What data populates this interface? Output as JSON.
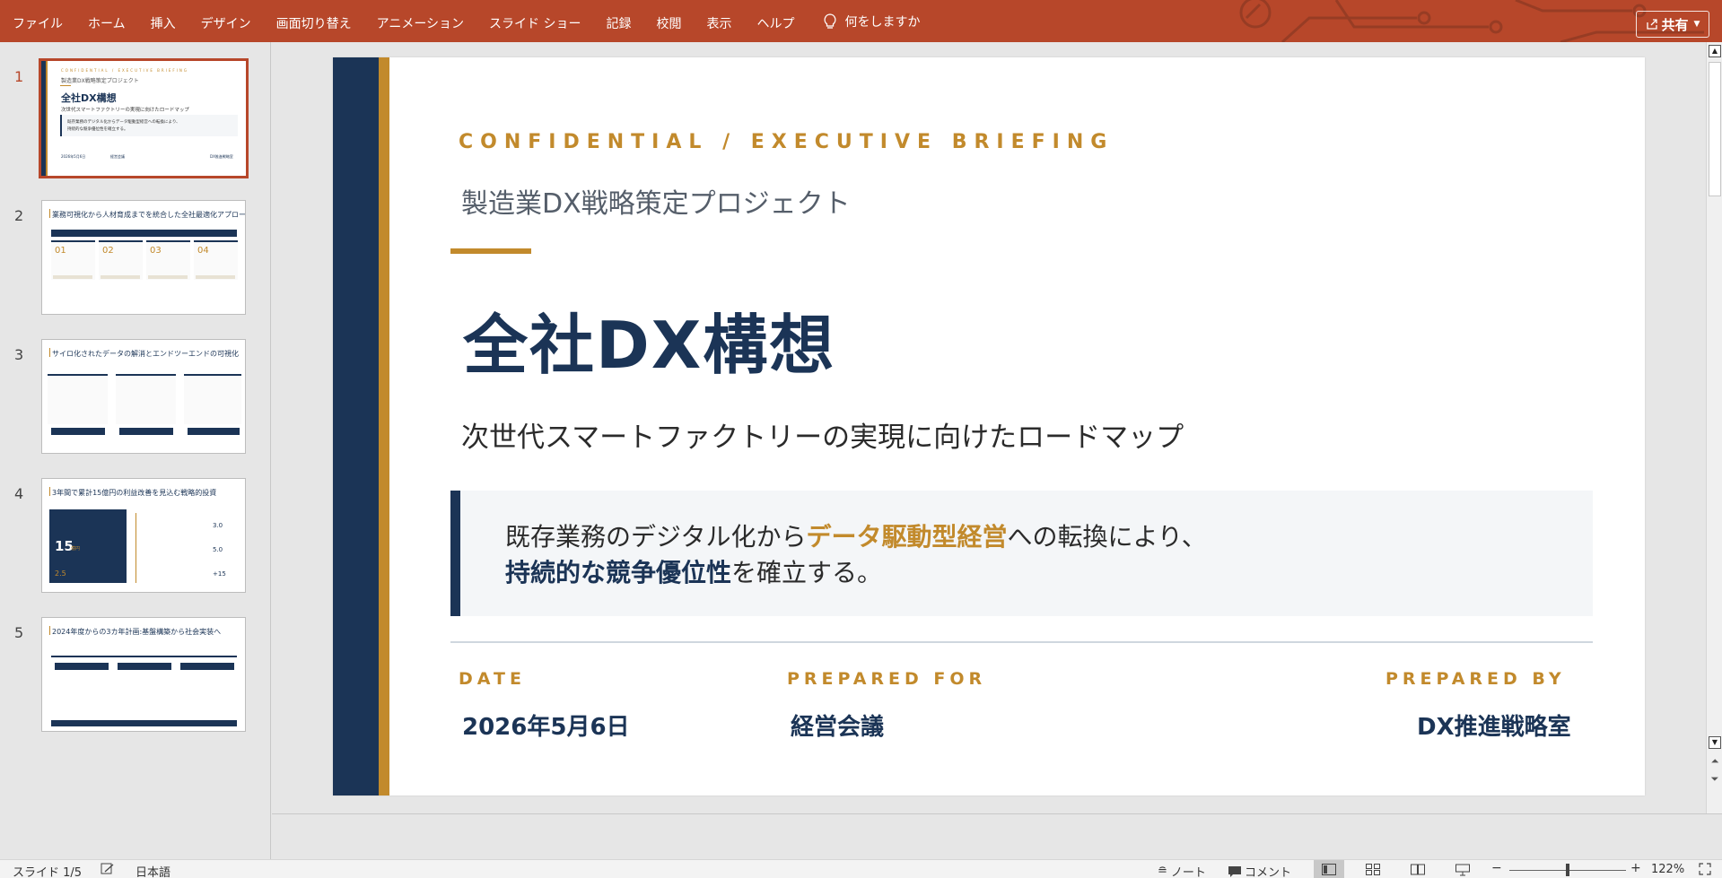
{
  "ribbon": {
    "tabs": [
      "ファイル",
      "ホーム",
      "挿入",
      "デザイン",
      "画面切り替え",
      "アニメーション",
      "スライド ショー",
      "記録",
      "校閲",
      "表示",
      "ヘルプ"
    ],
    "tell_me": "何をしますか",
    "share_label": "共有",
    "bg_color": "#b7472a"
  },
  "thumbnails": [
    {
      "number": "1",
      "active": true
    },
    {
      "number": "2",
      "active": false
    },
    {
      "number": "3",
      "active": false
    },
    {
      "number": "4",
      "active": false
    },
    {
      "number": "5",
      "active": false
    }
  ],
  "thumb_text": {
    "t1": {
      "kicker": "CONFIDENTIAL / EXECUTIVE BRIEFING",
      "project": "製造業DX戦略策定プロジェクト",
      "title": "全社DX構想",
      "subtitle": "次世代スマートファクトリーの実現に向けたロードマップ",
      "callout_1": "既存業務のデジタル化からデータ駆動型経営への転換により、",
      "callout_2": "持続的な競争優位性を確立する。",
      "date": "2026年5月6日",
      "prepared_for": "経営会議",
      "prepared_by": "DX推進戦略室"
    },
    "t2": {
      "title": "業務可視化から人材育成までを統合した全社最適化アプローチ",
      "nums": [
        "01",
        "02",
        "03",
        "04"
      ]
    },
    "t3": {
      "title": "サイロ化されたデータの解消とエンドツーエンドの可視化"
    },
    "t4": {
      "title": "3年間で累計15億円の利益改善を見込む戦略的投資",
      "big_value": "15",
      "big_unit": "億円",
      "small_value": "2.5",
      "values": [
        "3.0",
        "5.0",
        "+15"
      ]
    },
    "t5": {
      "title": "2024年度からの3カ年計画:基盤構築から社会実装へ"
    }
  },
  "slide": {
    "kicker": "CONFIDENTIAL / EXECUTIVE BRIEFING",
    "project": "製造業DX戦略策定プロジェクト",
    "title": "全社DX構想",
    "subtitle": "次世代スマートファクトリーの実現に向けたロードマップ",
    "callout": {
      "line1_pre": "既存業務のデジタル化から",
      "line1_hl": "データ駆動型経営",
      "line1_post": "への転換により、",
      "line2_hl": "持続的な競争優位性",
      "line2_post": "を確立する。"
    },
    "meta": {
      "date_label": "DATE",
      "date_value": "2026年5月6日",
      "for_label": "PREPARED FOR",
      "for_value": "経営会議",
      "by_label": "PREPARED BY",
      "by_value": "DX推進戦略室"
    },
    "colors": {
      "navy": "#1b3456",
      "gold": "#c28a2c"
    }
  },
  "status": {
    "slide_indicator": "スライド 1/5",
    "language": "日本語",
    "notes_label": "ノート",
    "comments_label": "コメント",
    "zoom": "122%",
    "zoom_fraction": 0.5
  }
}
